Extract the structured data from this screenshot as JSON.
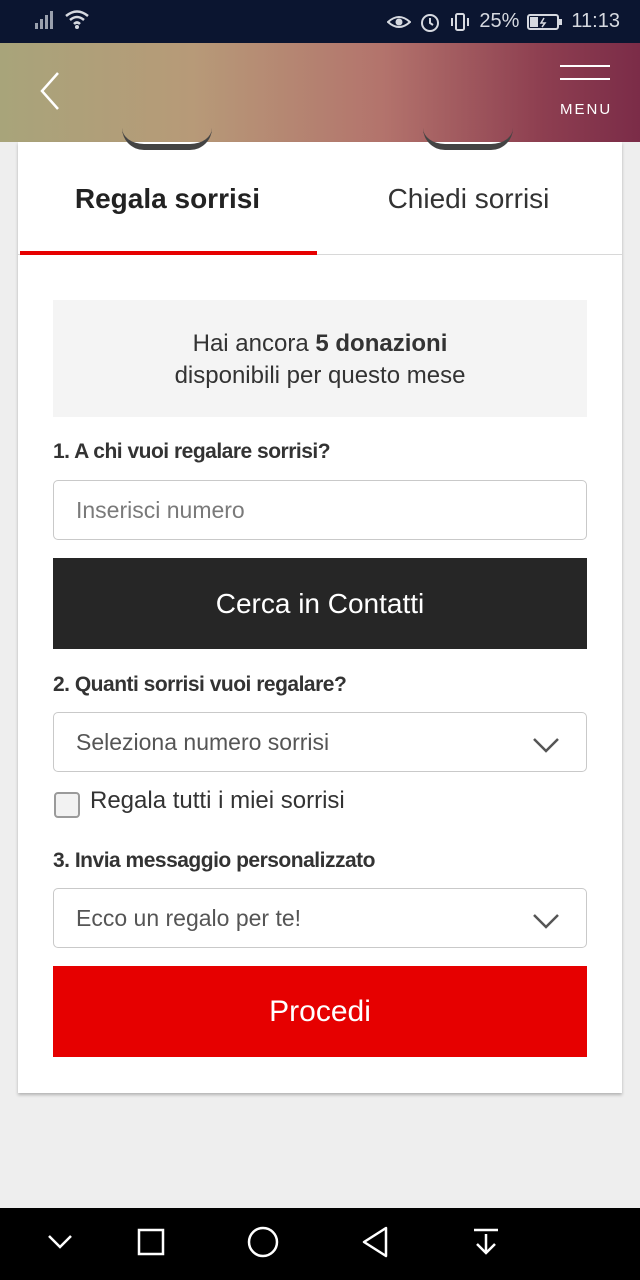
{
  "status_bar": {
    "battery": "25%",
    "time": "11:13",
    "icons": [
      "signal-icon",
      "wifi-icon",
      "eye-icon",
      "alarm-icon",
      "vibrate-icon",
      "battery-icon"
    ]
  },
  "header": {
    "back_icon": "chevron-left-icon",
    "menu_label": "MENU"
  },
  "tabs": [
    {
      "label": "Regala sorrisi",
      "active": true
    },
    {
      "label": "Chiedi sorrisi",
      "active": false
    }
  ],
  "info": {
    "prefix": "Hai ancora ",
    "highlight": "5 donazioni",
    "suffix": "disponibili per questo mese"
  },
  "form": {
    "step1_label": "1. A chi vuoi regalare sorrisi?",
    "number_placeholder": "Inserisci numero",
    "contacts_button": "Cerca in Contatti",
    "step2_label": "2. Quanti sorrisi vuoi regalare?",
    "smiles_select": "Seleziona numero sorrisi",
    "checkbox_label": "Regala tutti i miei sorrisi",
    "step3_label": "3. Invia messaggio personalizzato",
    "message_select": "Ecco un regalo per te!",
    "proceed_button": "Procedi"
  },
  "colors": {
    "accent": "#e60000",
    "dark_button": "#262626",
    "status_bar": "#0b1530"
  },
  "nav_bar": [
    "chevron-down-icon",
    "square-icon",
    "circle-icon",
    "triangle-back-icon",
    "download-icon"
  ]
}
